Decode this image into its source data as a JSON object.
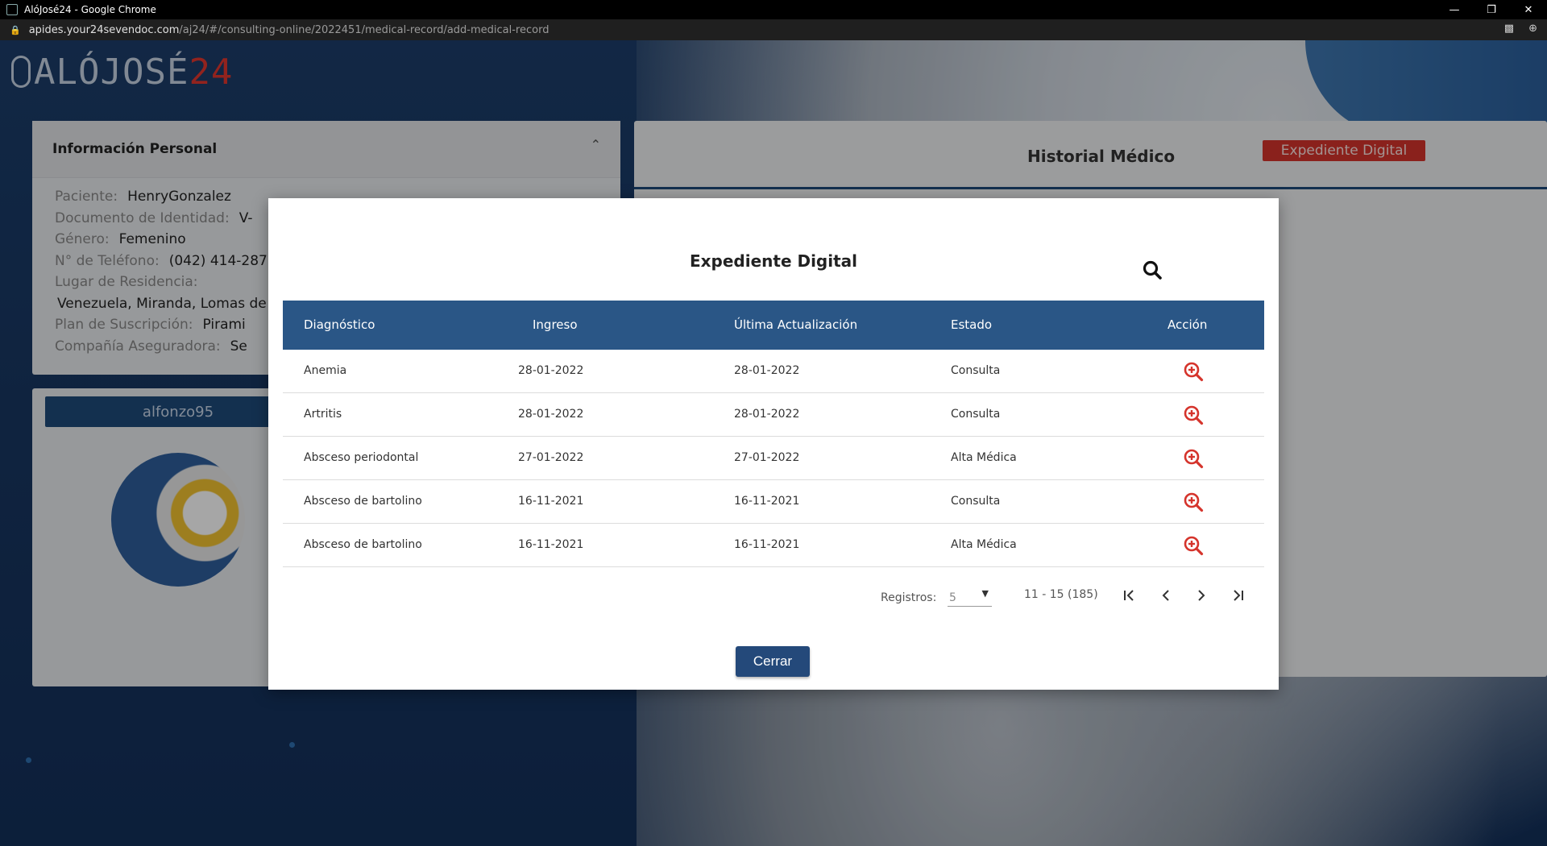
{
  "browser": {
    "window_title": "AlóJosé24 - Google Chrome",
    "url_host": "apides.your24sevendoc.com",
    "url_path": "/aj24/#/consulting-online/2022451/medical-record/add-medical-record"
  },
  "logo": {
    "text_main": "ALÓJOSÉ",
    "text_accent": "24"
  },
  "personal": {
    "title": "Información Personal",
    "fields": [
      {
        "label": "Paciente:",
        "value": "HenryGonzalez"
      },
      {
        "label": "Documento de Identidad:",
        "value": "V-"
      },
      {
        "label": "Género:",
        "value": "Femenino"
      },
      {
        "label": "N° de Teléfono:",
        "value": "(042) 414-287"
      },
      {
        "label": "Lugar de Residencia:",
        "value": ""
      },
      {
        "label": "",
        "value": "Venezuela, Miranda, Lomas de"
      },
      {
        "label": "Plan de Suscripción:",
        "value": "Pirami"
      },
      {
        "label": "Compañía Aseguradora:",
        "value": "Se"
      }
    ]
  },
  "user": {
    "username": "alfonzo95"
  },
  "history": {
    "title": "Historial Médico",
    "badge": "Expediente Digital"
  },
  "modal": {
    "title": "Expediente Digital",
    "columns": [
      "Diagnóstico",
      "Ingreso",
      "Última Actualización",
      "Estado",
      "Acción"
    ],
    "rows": [
      {
        "diagnostico": "Anemia",
        "ingreso": "28-01-2022",
        "actualizacion": "28-01-2022",
        "estado": "Consulta"
      },
      {
        "diagnostico": "Artritis",
        "ingreso": "28-01-2022",
        "actualizacion": "28-01-2022",
        "estado": "Consulta"
      },
      {
        "diagnostico": "Absceso periodontal",
        "ingreso": "27-01-2022",
        "actualizacion": "27-01-2022",
        "estado": "Alta Médica"
      },
      {
        "diagnostico": "Absceso de bartolino",
        "ingreso": "16-11-2021",
        "actualizacion": "16-11-2021",
        "estado": "Consulta"
      },
      {
        "diagnostico": "Absceso de bartolino",
        "ingreso": "16-11-2021",
        "actualizacion": "16-11-2021",
        "estado": "Alta Médica"
      }
    ],
    "pager": {
      "label": "Registros:",
      "page_size": "5",
      "range": "11 - 15 (185)"
    },
    "close_label": "Cerrar"
  },
  "colors": {
    "primary": "#2a5686",
    "accent": "#d5342c",
    "zoom_icon": "#d5342c"
  }
}
